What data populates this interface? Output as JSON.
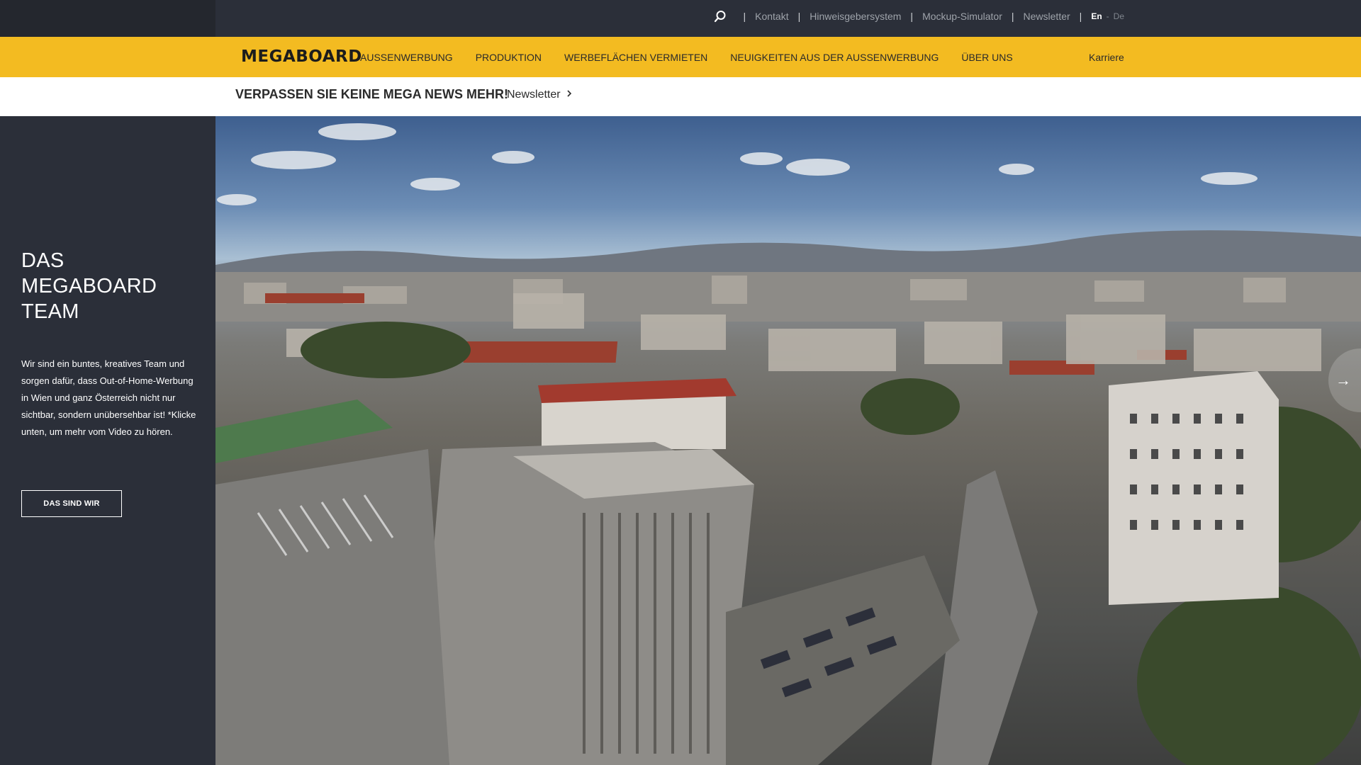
{
  "topbar": {
    "links": [
      "Kontakt",
      "Hinweisgebersystem",
      "Mockup-Simulator",
      "Newsletter"
    ],
    "lang_en": "En",
    "lang_dash": "-",
    "lang_de": "De",
    "search_icon": "search-icon"
  },
  "nav": {
    "logo": "MEGABOARD",
    "items": [
      "AUSSENWERBUNG",
      "PRODUKTION",
      "WERBEFLÄCHEN VERMIETEN",
      "NEUIGKEITEN AUS DER AUSSENWERBUNG",
      "ÜBER UNS"
    ],
    "career": "Karriere"
  },
  "strip": {
    "headline": "VERPASSEN SIE KEINE MEGA NEWS MEHR!",
    "newsletter_label": "Newsletter",
    "arrow_icon": "chevron-right-icon"
  },
  "panel": {
    "title": "DAS MEGABOARD TEAM",
    "text": "Wir sind ein buntes, kreatives Team und sorgen dafür, dass Out-of-Home-Werbung in Wien und ganz Österreich nicht nur sichtbar, sondern unübersehbar ist! *Klicke unten, um mehr vom Video zu hören.",
    "button": "DAS SIND WIR"
  },
  "hero": {
    "next_arrow": "→",
    "next_icon": "arrow-right-icon"
  }
}
